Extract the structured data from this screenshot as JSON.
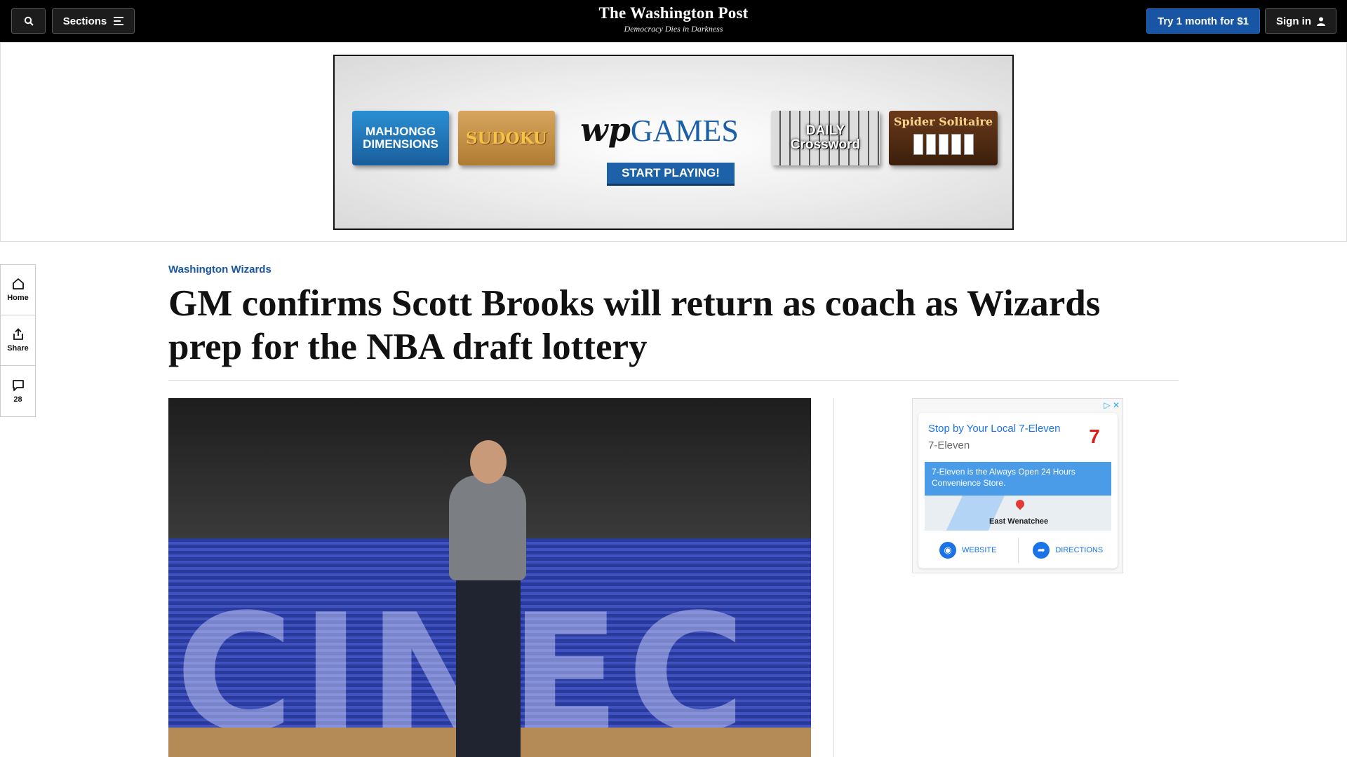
{
  "header": {
    "sections_label": "Sections",
    "logo": "The Washington Post",
    "tagline": "Democracy Dies in Darkness",
    "subscribe_label": "Try 1 month for $1",
    "signin_label": "Sign in"
  },
  "top_ad": {
    "tiles": [
      "MAHJONGG DIMENSIONS",
      "SUDOKU",
      "DAILY Crossword",
      "Spider Solitaire"
    ],
    "logo_mark": "wp",
    "logo_word": "GAMES",
    "cta": "START PLAYING!"
  },
  "rail": {
    "home": "Home",
    "share": "Share",
    "comments_count": "28"
  },
  "article": {
    "kicker": "Washington Wizards",
    "headline": "GM confirms Scott Brooks will return as coach as Wizards prep for the NBA draft lottery",
    "photo_text": "CINEC"
  },
  "side_ad": {
    "title": "Stop by Your Local 7-Eleven",
    "advertiser": "7-Eleven",
    "logo": "7",
    "description": "7-Eleven is the Always Open 24 Hours Convenience Store.",
    "map_place": "East Wenatchee",
    "website_label": "WEBSITE",
    "directions_label": "DIRECTIONS"
  },
  "colors": {
    "accent": "#1955a5",
    "topbar": "#000000"
  }
}
